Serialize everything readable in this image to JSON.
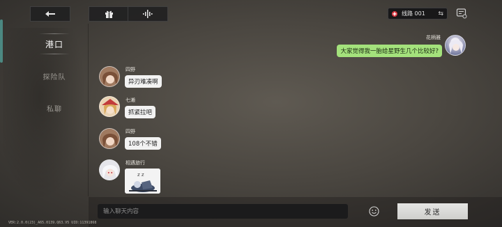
{
  "topbar": {
    "back_icon": "back-arrow-icon",
    "gift_icon": "gift-icon",
    "voice_icon": "audio-wave-icon",
    "server_label": "线路 001",
    "server_swap_glyph": "⇆",
    "settings_icon": "chat-settings-icon"
  },
  "sidebar": {
    "items": [
      {
        "label": "港口",
        "active": true
      },
      {
        "label": "探险队",
        "active": false
      },
      {
        "label": "私聊",
        "active": false
      }
    ]
  },
  "messages": [
    {
      "sender": "花柄雅",
      "text": "大家觉得我一胎给星野生几个比较好?",
      "mine": true,
      "avatar": "white-hair-girl-avatar"
    },
    {
      "sender": "四野",
      "text": "异刃难凑啊",
      "mine": false,
      "avatar": "brown-hair-girl-avatar"
    },
    {
      "sender": "七濑",
      "text": "抓紧拉吧",
      "mine": false,
      "avatar": "blonde-hat-girl-avatar"
    },
    {
      "sender": "四野",
      "text": "108个不错",
      "mine": false,
      "avatar": "brown-hair-girl-avatar"
    },
    {
      "sender": "相遇旅行",
      "text": "",
      "mine": false,
      "avatar": "silver-hair-girl-avatar",
      "sticker": "sleeping-character-sticker",
      "sticker_text": "z z"
    }
  ],
  "input": {
    "placeholder": "输入聊天内容",
    "value": ""
  },
  "emoji_icon": "emoji-smile-icon",
  "send_label": "发送",
  "footer": {
    "version": "VER:2.0.0(23)_A65.0139.Q63.V5    UID:11391868"
  },
  "colors": {
    "mine_bubble": "#a4e27c",
    "other_bubble": "#f2f2f2",
    "server_dot": "#d8343f"
  }
}
